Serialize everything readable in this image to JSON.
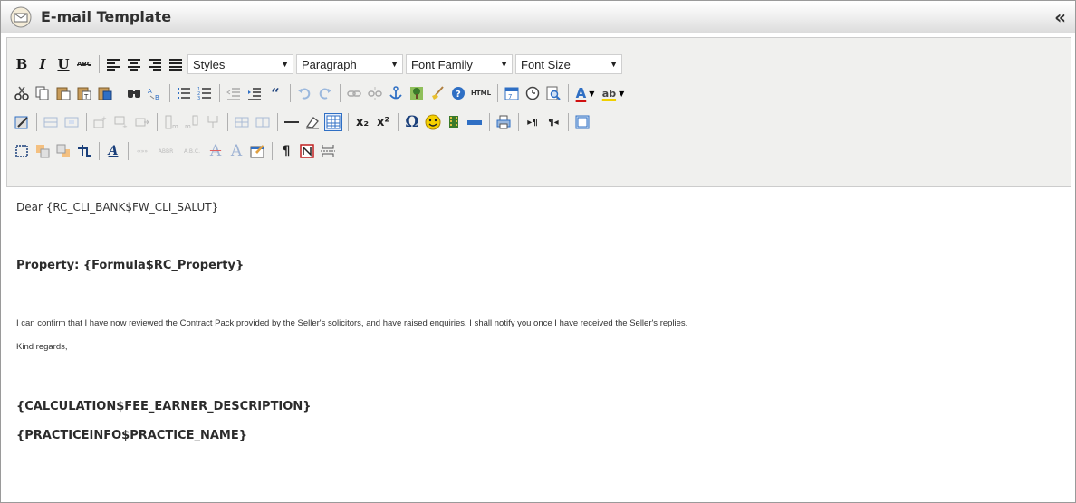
{
  "window": {
    "title": "E-mail Template",
    "title_icon": "envelope-icon",
    "collapse_label": "«"
  },
  "toolbar": {
    "format_buttons": [
      {
        "name": "bold",
        "label": "B"
      },
      {
        "name": "italic",
        "label": "I"
      },
      {
        "name": "underline",
        "label": "U"
      },
      {
        "name": "strikethrough",
        "label": "ABC"
      }
    ],
    "dropdowns": {
      "styles": "Styles",
      "paragraph": "Paragraph",
      "font_family": "Font Family",
      "font_size": "Font Size"
    },
    "row2_icons": [
      "cut-icon",
      "copy-icon",
      "paste-icon",
      "paste-text-icon",
      "paste-word-icon",
      "find-icon",
      "replace-icon",
      "bullet-list-icon",
      "numbered-list-icon",
      "outdent-icon",
      "indent-icon",
      "blockquote-icon",
      "undo-icon",
      "redo-icon",
      "link-icon",
      "unlink-icon",
      "anchor-icon",
      "image-icon",
      "cleanup-icon",
      "help-icon",
      "html-icon",
      "insert-date-icon",
      "insert-time-icon",
      "preview-icon",
      "text-color-icon",
      "highlight-color-icon"
    ],
    "row3_icons": [
      "table-props-icon",
      "row-props-icon",
      "cell-props-icon",
      "insert-row-before-icon",
      "insert-row-after-icon",
      "delete-row-icon",
      "insert-col-before-icon",
      "insert-col-after-icon",
      "delete-col-icon",
      "merge-cells-icon",
      "split-cells-icon",
      "horizontal-rule-icon",
      "remove-format-icon",
      "visual-aid-icon",
      "subscript-icon",
      "superscript-icon",
      "special-char-icon",
      "emoticon-icon",
      "media-icon",
      "advanced-hr-icon",
      "print-icon",
      "ltr-icon",
      "rtl-icon",
      "fullscreen-icon"
    ],
    "row4_icons": [
      "insert-layer-icon",
      "move-forward-icon",
      "move-backward-icon",
      "absolute-position-icon",
      "style-props-icon",
      "cite-icon",
      "abbr-icon",
      "acronym-icon",
      "del-icon",
      "ins-icon",
      "attributes-icon",
      "show-blocks-icon",
      "non-breaking-icon",
      "page-break-icon"
    ],
    "labels": {
      "html": "HTML",
      "subscript": "x₂",
      "superscript": "x²",
      "omega": "Ω",
      "pilcrow": "¶",
      "font_color": "A",
      "highlight": "ab",
      "cite": "‹‹»»",
      "abbr": "ABBR",
      "acronym": "A.B.C."
    },
    "colors": {
      "font_color": "#d01010",
      "highlight": "#f0d000",
      "accent_blue": "#2f6fc4"
    }
  },
  "editor": {
    "salutation": "Dear {RC_CLI_BANK$FW_CLI_SALUT}",
    "property_line": "Property: {Formula$RC_Property}",
    "body_line1": "I can confirm that I have now reviewed the Contract Pack provided by the Seller's solicitors, and have raised enquiries.  I shall notify you once I have received the Seller's replies.",
    "body_line2": "Kind regards,",
    "fee_earner": "{CALCULATION$FEE_EARNER_DESCRIPTION}",
    "practice_name": "{PRACTICEINFO$PRACTICE_NAME}"
  }
}
